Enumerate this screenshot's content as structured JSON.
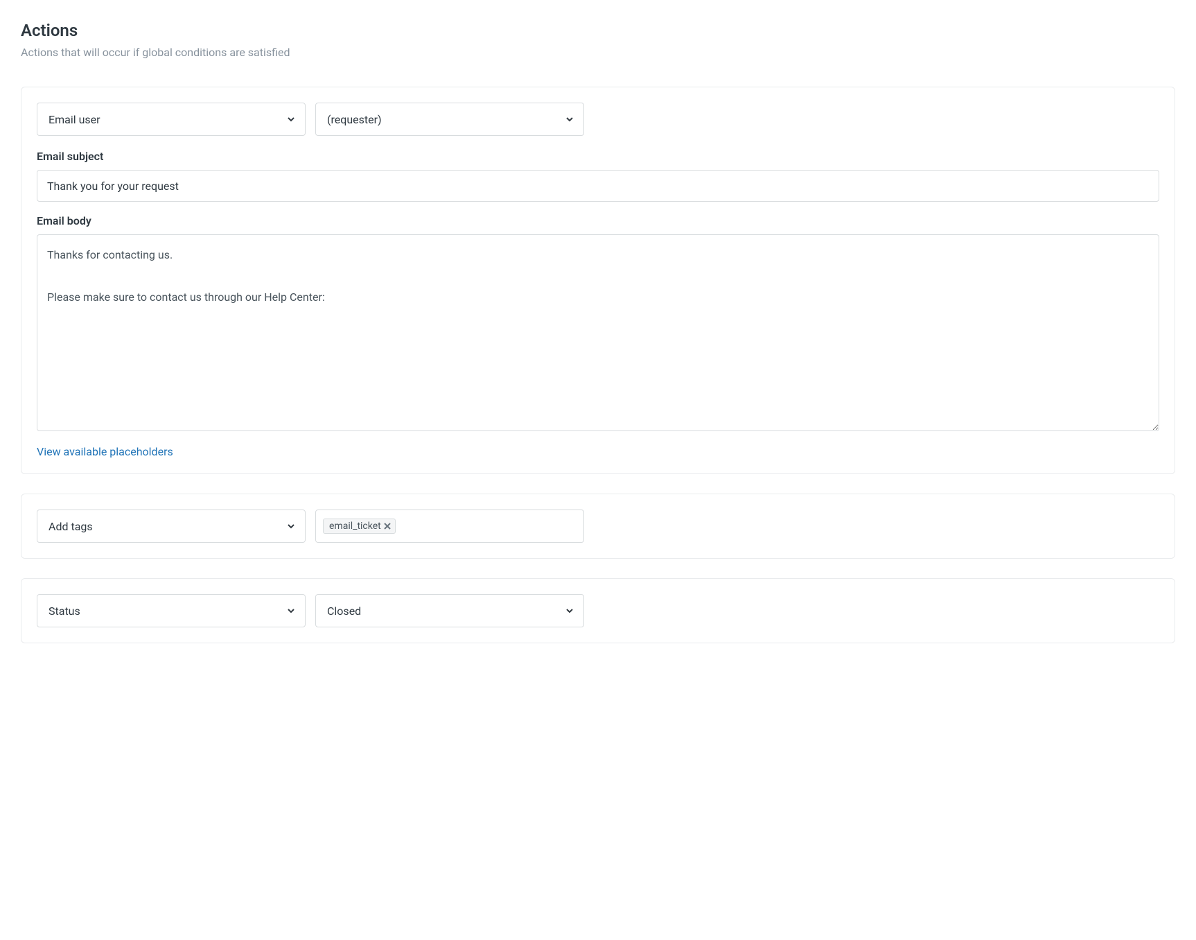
{
  "header": {
    "title": "Actions",
    "subtitle": "Actions that will occur if global conditions are satisfied"
  },
  "actions": {
    "email": {
      "action_type": "Email user",
      "recipient": "(requester)",
      "subject_label": "Email subject",
      "subject_value": "Thank you for your request",
      "body_label": "Email body",
      "body_value": "Thanks for contacting us.\n\nPlease make sure to contact us through our Help Center:",
      "placeholders_link": "View available placeholders"
    },
    "tags": {
      "action_type": "Add tags",
      "values": [
        "email_ticket"
      ]
    },
    "status": {
      "action_type": "Status",
      "value": "Closed"
    }
  }
}
